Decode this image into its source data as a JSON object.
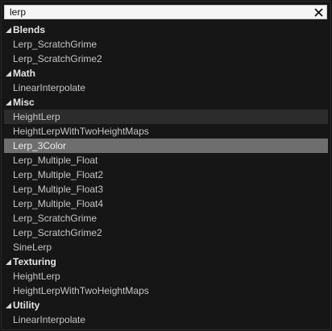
{
  "search": {
    "value": "lerp"
  },
  "categories": [
    {
      "label": "Blends",
      "items": [
        "Lerp_ScratchGrime",
        "Lerp_ScratchGrime2"
      ]
    },
    {
      "label": "Math",
      "items": [
        "LinearInterpolate"
      ]
    },
    {
      "label": "Misc",
      "items": [
        "HeightLerp",
        "HeightLerpWithTwoHeightMaps",
        "Lerp_3Color",
        "Lerp_Multiple_Float",
        "Lerp_Multiple_Float2",
        "Lerp_Multiple_Float3",
        "Lerp_Multiple_Float4",
        "Lerp_ScratchGrime",
        "Lerp_ScratchGrime2",
        "SineLerp"
      ]
    },
    {
      "label": "Texturing",
      "items": [
        "HeightLerp",
        "HeightLerpWithTwoHeightMaps"
      ]
    },
    {
      "label": "Utility",
      "items": [
        "LinearInterpolate"
      ]
    }
  ],
  "state": {
    "hovered": "Misc/HeightLerp",
    "selected": "Misc/Lerp_3Color"
  },
  "colors": {
    "selected_bg": "#6e6e6e",
    "hover_bg": "#2c2c2c",
    "panel_bg": "#161616"
  },
  "icons": {
    "expand": "expanded-triangle-icon",
    "clear": "close-icon"
  }
}
